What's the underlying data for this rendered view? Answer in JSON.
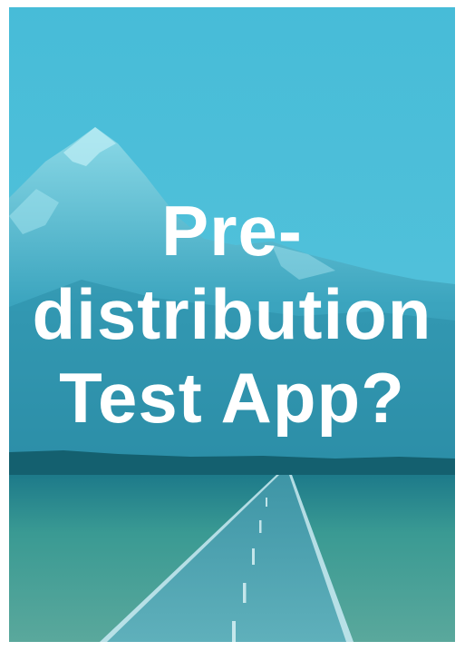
{
  "cover": {
    "title_lines": [
      "Pre-",
      "distribution",
      "Test App?"
    ],
    "overlay_color": "#33b7d0",
    "text_color": "#ffffff"
  }
}
